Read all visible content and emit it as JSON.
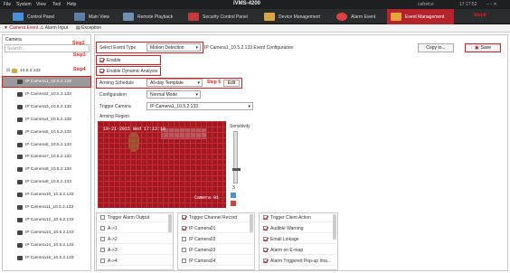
{
  "menubar": {
    "items": [
      "File",
      "System",
      "View",
      "Tool",
      "Help"
    ],
    "app_title": "iVMS-4200",
    "user": "cafrelco",
    "clock": "17:17:52"
  },
  "toolbar": {
    "items": [
      "Control Panel",
      "Main View",
      "Remote Playback",
      "Security Control Panel",
      "Device Management",
      "Alarm Event",
      "Event Management"
    ],
    "step_label": "Step8"
  },
  "subtabs": {
    "items": [
      "Camera Event",
      "Alarm Input",
      "Exception"
    ]
  },
  "left": {
    "label": "Camera",
    "search_placeholder": "Search...",
    "root": "10.5.2.133",
    "cameras": [
      "IP Camera1_10.5.2.133",
      "IP Camera2_10.5.2.133",
      "IP Camera3_10.5.2.133",
      "IP Camera4_10.5.2.133",
      "IP Camera5_10.5.2.133",
      "IP Camera6_10.5.2.133",
      "IP Camera7_10.5.2.133",
      "IP Camera8_10.5.2.133",
      "IP Camera9_10.5.2.133",
      "IP Camera10_10.5.2.133",
      "IP Camera11_10.5.2.133",
      "IP Camera12_10.5.2.133",
      "IP Camera13_10.5.2.133",
      "IP Camera14_10.5.2.133",
      "IP Camera15_10.5.2.133"
    ]
  },
  "steps": {
    "s2": "Step2",
    "s3": "Step3",
    "s4": "Step4",
    "s5": "Step 5"
  },
  "config": {
    "event_type_label": "Select Event Type",
    "event_type_value": "Motion Detection",
    "event_config_text": "IP Camera1_10.5.2.133 Event Configuration",
    "copy_to": "Copy to...",
    "save": "Save",
    "enable": "Enable",
    "enable_dynamic": "Enable Dynamic Analysis",
    "arming_label": "Arming Schedule",
    "arming_value": "All-day Template",
    "edit": "Edit",
    "configuration_label": "Configuration",
    "configuration_value": "Normal Mode",
    "trigger_camera_label": "Trigger Camera",
    "trigger_camera_value": "IP Camera1_10.5.2.133",
    "arming_region_label": "Arming Region",
    "sensitivity_label": "Sensitivity",
    "sensitivity_value": "3",
    "video_timestamp": "10-21-2015 Wed 17:12:10",
    "video_cam_tag": "Camera 01"
  },
  "lists": {
    "alarm_output": {
      "header": "Trigger Alarm Output",
      "items": [
        "A->1",
        "A->2",
        "A->3",
        "A->4"
      ]
    },
    "channel_record": {
      "header": "Trigger Channel Record",
      "items": [
        "IP Camera01",
        "IP Camera02",
        "IP Camera03",
        "IP Camera04"
      ]
    },
    "client_action": {
      "header": "Trigger Client Action",
      "items": [
        "Audible Warning",
        "Email Linkage",
        "Alarm on E-map",
        "Alarm Triggered Pop-up Ima..."
      ]
    }
  },
  "colors": {
    "accent": "#b3232b",
    "step_red": "#e01a1a",
    "video_bg": "#9d1a23"
  }
}
